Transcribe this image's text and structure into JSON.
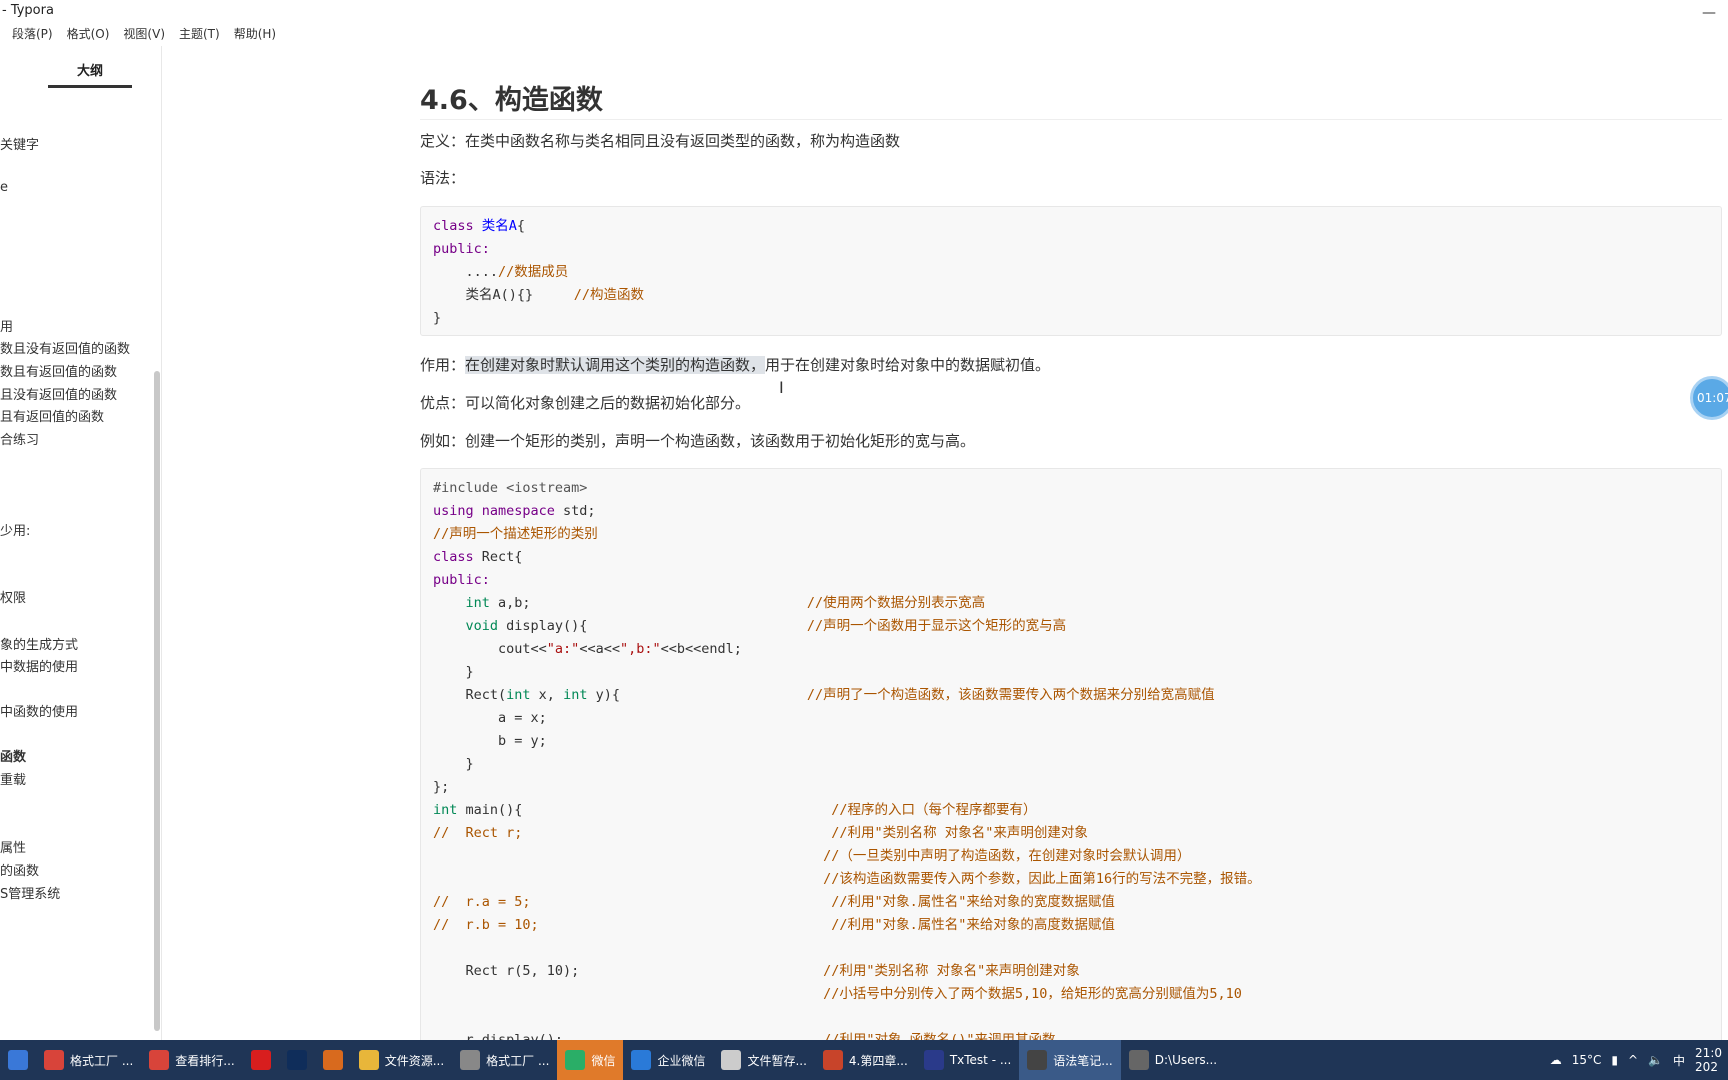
{
  "window": {
    "title": "- Typora"
  },
  "menu": [
    "段落(P)",
    "格式(O)",
    "视图(V)",
    "主题(T)",
    "帮助(H)"
  ],
  "sidebar": {
    "tab_label": "大纲",
    "items": [
      {
        "label": "关键字",
        "bold": false
      },
      {
        "label": "e",
        "bold": false
      },
      {
        "label": "用",
        "bold": false
      },
      {
        "label": "数且没有返回值的函数",
        "bold": false
      },
      {
        "label": "数且有返回值的函数",
        "bold": false
      },
      {
        "label": "且没有返回值的函数",
        "bold": false
      },
      {
        "label": "且有返回值的函数",
        "bold": false
      },
      {
        "label": "合练习",
        "bold": false
      },
      {
        "label": "少用:",
        "bold": false
      },
      {
        "label": "权限",
        "bold": false
      },
      {
        "label": "象的生成方式",
        "bold": false
      },
      {
        "label": "中数据的使用",
        "bold": false
      },
      {
        "label": "中函数的使用",
        "bold": false
      },
      {
        "label": "函数",
        "bold": true
      },
      {
        "label": "重载",
        "bold": false
      },
      {
        "label": "属性",
        "bold": false
      },
      {
        "label": "的函数",
        "bold": false
      },
      {
        "label": "S管理系统",
        "bold": false
      }
    ],
    "bottom_back": "<",
    "bottom_source": "</>"
  },
  "doc": {
    "heading": "4.6、构造函数",
    "definition": "定义：在类中函数名称与类名相同且没有返回类型的函数，称为构造函数",
    "syntax_label": "语法：",
    "code1": [
      [
        {
          "t": "class ",
          "c": "kw"
        },
        {
          "t": "类名A",
          "c": "df"
        },
        {
          "t": "{",
          "c": ""
        }
      ],
      [
        {
          "t": "public:",
          "c": "kw"
        }
      ],
      [
        {
          "t": "    ....",
          "c": ""
        },
        {
          "t": "//数据成员",
          "c": "cm"
        }
      ],
      [
        {
          "t": "    类名A(){}     ",
          "c": ""
        },
        {
          "t": "//构造函数",
          "c": "cm"
        }
      ],
      [
        {
          "t": "}",
          "c": ""
        }
      ]
    ],
    "purpose_label": "作用：",
    "purpose_highlight": "在创建对象时默认调用这个类别的构造函数，",
    "purpose_rest": "用于在创建对象时给对象中的数据赋初值。",
    "advantage": "优点：可以简化对象创建之后的数据初始化部分。",
    "example": "例如：创建一个矩形的类别，声明一个构造函数，该函数用于初始化矩形的宽与高。",
    "code2": [
      [
        {
          "t": "#include <iostream>",
          "c": "ph"
        }
      ],
      [
        {
          "t": "using namespace ",
          "c": "kw"
        },
        {
          "t": "std;",
          "c": ""
        }
      ],
      [
        {
          "t": "//声明一个描述矩形的类别",
          "c": "cm"
        }
      ],
      [
        {
          "t": "class ",
          "c": "kw"
        },
        {
          "t": "Rect{",
          "c": ""
        }
      ],
      [
        {
          "t": "public:",
          "c": "kw"
        }
      ],
      [
        {
          "t": "    ",
          "c": ""
        },
        {
          "t": "int ",
          "c": "ty"
        },
        {
          "t": "a,b;                                  ",
          "c": ""
        },
        {
          "t": "//使用两个数据分别表示宽高",
          "c": "cm"
        }
      ],
      [
        {
          "t": "    ",
          "c": ""
        },
        {
          "t": "void ",
          "c": "ty"
        },
        {
          "t": "display(){                           ",
          "c": ""
        },
        {
          "t": "//声明一个函数用于显示这个矩形的宽与高",
          "c": "cm"
        }
      ],
      [
        {
          "t": "        cout<<",
          "c": ""
        },
        {
          "t": "\"a:\"",
          "c": "st"
        },
        {
          "t": "<<a<<",
          "c": ""
        },
        {
          "t": "\",b:\"",
          "c": "st"
        },
        {
          "t": "<<b<<endl;",
          "c": ""
        }
      ],
      [
        {
          "t": "    }",
          "c": ""
        }
      ],
      [
        {
          "t": "    Rect(",
          "c": ""
        },
        {
          "t": "int ",
          "c": "ty"
        },
        {
          "t": "x, ",
          "c": ""
        },
        {
          "t": "int ",
          "c": "ty"
        },
        {
          "t": "y){                       ",
          "c": ""
        },
        {
          "t": "//声明了一个构造函数，该函数需要传入两个数据来分别给宽高赋值",
          "c": "cm"
        }
      ],
      [
        {
          "t": "        a = x;",
          "c": ""
        }
      ],
      [
        {
          "t": "        b = y;",
          "c": ""
        }
      ],
      [
        {
          "t": "    }",
          "c": ""
        }
      ],
      [
        {
          "t": "};",
          "c": ""
        }
      ],
      [
        {
          "t": "int ",
          "c": "ty"
        },
        {
          "t": "main(){                                      ",
          "c": ""
        },
        {
          "t": "//程序的入口（每个程序都要有）",
          "c": "cm"
        }
      ],
      [
        {
          "t": "//  Rect r;                                      //利用\"类别名称 对象名\"来声明创建对象",
          "c": "cm"
        }
      ],
      [
        {
          "t": "                                                ",
          "c": ""
        },
        {
          "t": "//（一旦类别中声明了构造函数，在创建对象时会默认调用）",
          "c": "cm"
        }
      ],
      [
        {
          "t": "                                                ",
          "c": ""
        },
        {
          "t": "//该构造函数需要传入两个参数，因此上面第16行的写法不完整，报错。",
          "c": "cm"
        }
      ],
      [
        {
          "t": "//  r.a = 5;                                     //利用\"对象.属性名\"来给对象的宽度数据赋值",
          "c": "cm"
        }
      ],
      [
        {
          "t": "//  r.b = 10;                                    //利用\"对象.属性名\"来给对象的高度数据赋值",
          "c": "cm"
        }
      ],
      [
        {
          "t": "",
          "c": ""
        }
      ],
      [
        {
          "t": "    Rect r(5, 10);                              ",
          "c": ""
        },
        {
          "t": "//利用\"类别名称 对象名\"来声明创建对象",
          "c": "cm"
        }
      ],
      [
        {
          "t": "                                                ",
          "c": ""
        },
        {
          "t": "//小括号中分别传入了两个数据5,10，给矩形的宽高分别赋值为5,10",
          "c": "cm"
        }
      ],
      [
        {
          "t": "",
          "c": ""
        }
      ],
      [
        {
          "t": "    r.display();                                ",
          "c": ""
        },
        {
          "t": "//利用\"对象.函数名()\"来调用其函数",
          "c": "cm"
        }
      ]
    ]
  },
  "badge": {
    "time": "01:07"
  },
  "taskbar": {
    "items": [
      {
        "label": "",
        "icon": "windows-start-icon",
        "color": "#3a78d8",
        "state": ""
      },
      {
        "label": "格式工厂 ...",
        "icon": "chrome-icon",
        "color": "#d8443a",
        "state": ""
      },
      {
        "label": "查看排行...",
        "icon": "chrome-icon",
        "color": "#d8443a",
        "state": ""
      },
      {
        "label": "",
        "icon": "youdao-icon",
        "color": "#d81e1e",
        "state": ""
      },
      {
        "label": "",
        "icon": "photoshop-icon",
        "color": "#0f2d5a",
        "state": ""
      },
      {
        "label": "",
        "icon": "app-icon",
        "color": "#d86a1e",
        "state": ""
      },
      {
        "label": "文件资源...",
        "icon": "folder-icon",
        "color": "#e8b63a",
        "state": ""
      },
      {
        "label": "格式工厂 ...",
        "icon": "format-factory-icon",
        "color": "#888888",
        "state": ""
      },
      {
        "label": "微信",
        "icon": "wechat-icon",
        "color": "#2aae67",
        "state": "active"
      },
      {
        "label": "企业微信",
        "icon": "wework-icon",
        "color": "#2a7ad8",
        "state": ""
      },
      {
        "label": "文件暂存...",
        "icon": "file-store-icon",
        "color": "#cccccc",
        "state": ""
      },
      {
        "label": "4.第四章...",
        "icon": "powerpoint-icon",
        "color": "#c8442a",
        "state": ""
      },
      {
        "label": "TxTest - ...",
        "icon": "devcpp-icon",
        "color": "#2a3a8a",
        "state": ""
      },
      {
        "label": "语法笔记...",
        "icon": "typora-icon",
        "color": "#444444",
        "state": "selected"
      },
      {
        "label": "D:\\Users...",
        "icon": "explorer-window-icon",
        "color": "#666666",
        "state": ""
      }
    ],
    "weather": "15°C",
    "lang": "中",
    "time": "21:0",
    "date": "202"
  }
}
